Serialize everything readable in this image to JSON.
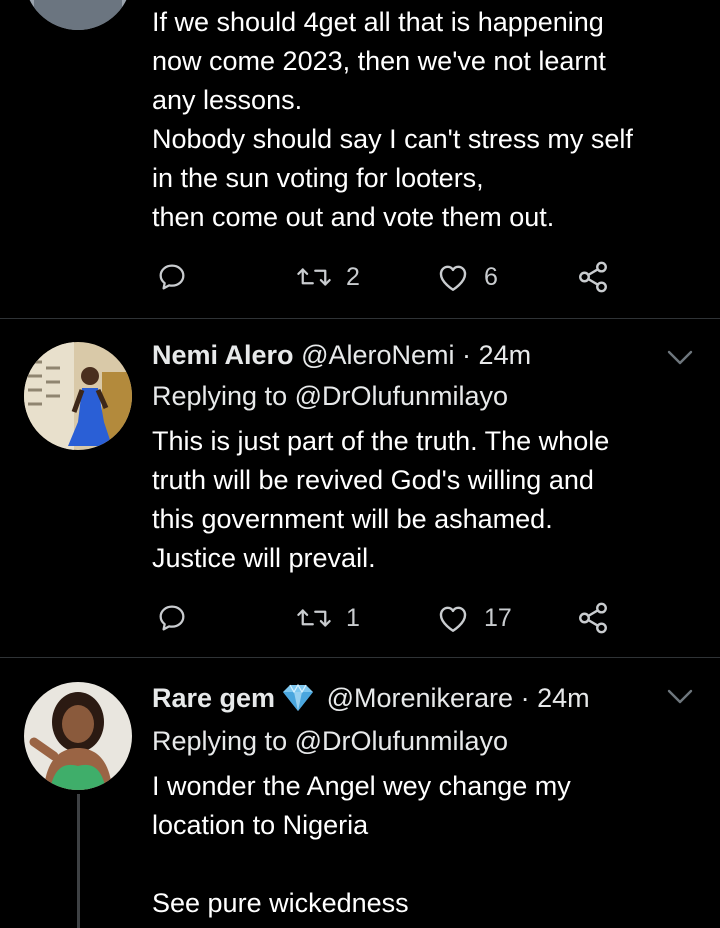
{
  "colors": {
    "background": "#000000",
    "text": "#e7e9ea",
    "icon": "#c9cccf",
    "divider": "#2f3336"
  },
  "tweets": [
    {
      "body": "If we should 4get all that is happening\nnow come 2023, then we've not learnt\nany lessons.\nNobody should say I can't stress my self\nin the sun voting for looters,\nthen come out and vote them out.",
      "retweets": "2",
      "likes": "6"
    },
    {
      "name": "Nemi Alero",
      "handle": "@AleroNemi",
      "separator": "·",
      "time": "24m",
      "replying_prefix": "Replying to",
      "replying_to": "@DrOlufunmilayo",
      "body": "This is just part of the truth. The whole\ntruth will be revived God's willing and\nthis government will be ashamed.\nJustice will prevail.",
      "retweets": "1",
      "likes": "17"
    },
    {
      "name": "Rare gem",
      "name_emoji": "gem-stone-icon",
      "handle": "@Morenikerare",
      "separator": "·",
      "time": "24m",
      "replying_prefix": "Replying to",
      "replying_to": "@DrOlufunmilayo",
      "body": "I wonder the Angel wey change my\nlocation to Nigeria\n\nSee pure wickedness"
    }
  ],
  "icons": {
    "reply": "reply-icon",
    "retweet": "retweet-icon",
    "like": "heart-icon",
    "share": "share-icon",
    "menu": "chevron-down-icon"
  }
}
